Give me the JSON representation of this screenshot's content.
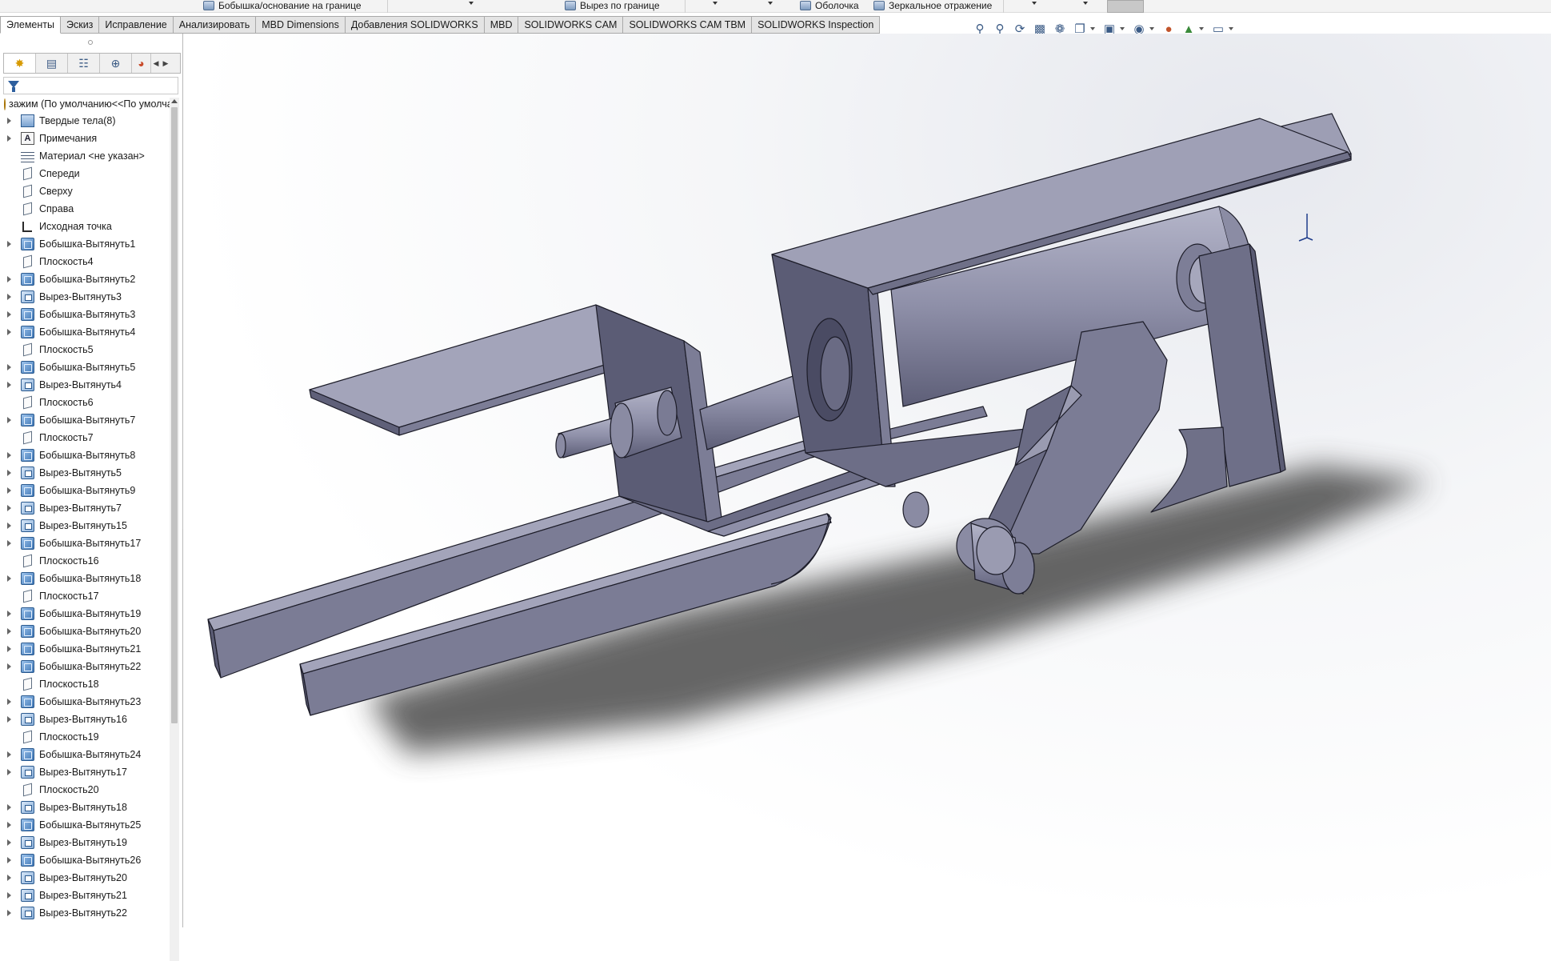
{
  "ribbon": {
    "boss_boundary": "Бобышка/основание на границе",
    "cut_boundary": "Вырез по границе",
    "shell": "Оболочка",
    "mirror": "Зеркальное отражение"
  },
  "tabs": [
    {
      "label": "Элементы",
      "active": true
    },
    {
      "label": "Эскиз",
      "active": false
    },
    {
      "label": "Исправление",
      "active": false
    },
    {
      "label": "Анализировать",
      "active": false
    },
    {
      "label": "MBD Dimensions",
      "active": false
    },
    {
      "label": "Добавления SOLIDWORKS",
      "active": false
    },
    {
      "label": "MBD",
      "active": false
    },
    {
      "label": "SOLIDWORKS CAM",
      "active": false
    },
    {
      "label": "SOLIDWORKS CAM TBM",
      "active": false
    },
    {
      "label": "SOLIDWORKS Inspection",
      "active": false
    }
  ],
  "hud_icons": [
    "zoom-to-fit-icon",
    "zoom-to-area-icon",
    "previous-view-icon",
    "section-view-icon",
    "dynamic-annotation-icon",
    "view-orientation-icon",
    "display-style-icon",
    "hide-show-icon",
    "edit-appearance-icon",
    "apply-scene-icon",
    "view-settings-icon"
  ],
  "panel_tabs": [
    "feature-manager-icon",
    "property-manager-icon",
    "configuration-manager-icon",
    "dimxpert-manager-icon",
    "display-manager-icon"
  ],
  "tree": {
    "root": "зажим  (По умолчанию<<По умолчанию>>",
    "items": [
      {
        "label": "Твердые тела(8)",
        "icon": "solid-bodies-icon",
        "expandable": true
      },
      {
        "label": "Примечания",
        "icon": "annotations-icon",
        "expandable": true
      },
      {
        "label": "Материал <не указан>",
        "icon": "material-icon",
        "expandable": false
      },
      {
        "label": "Спереди",
        "icon": "plane-icon",
        "expandable": false
      },
      {
        "label": "Сверху",
        "icon": "plane-icon",
        "expandable": false
      },
      {
        "label": "Справа",
        "icon": "plane-icon",
        "expandable": false
      },
      {
        "label": "Исходная точка",
        "icon": "origin-icon",
        "expandable": false
      },
      {
        "label": "Бобышка-Вытянуть1",
        "icon": "extrude-boss-icon",
        "expandable": true
      },
      {
        "label": "Плоскость4",
        "icon": "plane-icon",
        "expandable": false
      },
      {
        "label": "Бобышка-Вытянуть2",
        "icon": "extrude-boss-icon",
        "expandable": true
      },
      {
        "label": "Вырез-Вытянуть3",
        "icon": "extrude-cut-icon",
        "expandable": true
      },
      {
        "label": "Бобышка-Вытянуть3",
        "icon": "extrude-boss-icon",
        "expandable": true
      },
      {
        "label": "Бобышка-Вытянуть4",
        "icon": "extrude-boss-icon",
        "expandable": true
      },
      {
        "label": "Плоскость5",
        "icon": "plane-icon",
        "expandable": false
      },
      {
        "label": "Бобышка-Вытянуть5",
        "icon": "extrude-boss-icon",
        "expandable": true
      },
      {
        "label": "Вырез-Вытянуть4",
        "icon": "extrude-cut-icon",
        "expandable": true
      },
      {
        "label": "Плоскость6",
        "icon": "plane-icon",
        "expandable": false
      },
      {
        "label": "Бобышка-Вытянуть7",
        "icon": "extrude-boss-icon",
        "expandable": true
      },
      {
        "label": "Плоскость7",
        "icon": "plane-icon",
        "expandable": false
      },
      {
        "label": "Бобышка-Вытянуть8",
        "icon": "extrude-boss-icon",
        "expandable": true
      },
      {
        "label": "Вырез-Вытянуть5",
        "icon": "extrude-cut-icon",
        "expandable": true
      },
      {
        "label": "Бобышка-Вытянуть9",
        "icon": "extrude-boss-icon",
        "expandable": true
      },
      {
        "label": "Вырез-Вытянуть7",
        "icon": "extrude-cut-icon",
        "expandable": true
      },
      {
        "label": "Вырез-Вытянуть15",
        "icon": "extrude-cut-icon",
        "expandable": true
      },
      {
        "label": "Бобышка-Вытянуть17",
        "icon": "extrude-boss-icon",
        "expandable": true
      },
      {
        "label": "Плоскость16",
        "icon": "plane-icon",
        "expandable": false
      },
      {
        "label": "Бобышка-Вытянуть18",
        "icon": "extrude-boss-icon",
        "expandable": true
      },
      {
        "label": "Плоскость17",
        "icon": "plane-icon",
        "expandable": false
      },
      {
        "label": "Бобышка-Вытянуть19",
        "icon": "extrude-boss-icon",
        "expandable": true
      },
      {
        "label": "Бобышка-Вытянуть20",
        "icon": "extrude-boss-icon",
        "expandable": true
      },
      {
        "label": "Бобышка-Вытянуть21",
        "icon": "extrude-boss-icon",
        "expandable": true
      },
      {
        "label": "Бобышка-Вытянуть22",
        "icon": "extrude-boss-icon",
        "expandable": true
      },
      {
        "label": "Плоскость18",
        "icon": "plane-icon",
        "expandable": false
      },
      {
        "label": "Бобышка-Вытянуть23",
        "icon": "extrude-boss-icon",
        "expandable": true
      },
      {
        "label": "Вырез-Вытянуть16",
        "icon": "extrude-cut-icon",
        "expandable": true
      },
      {
        "label": "Плоскость19",
        "icon": "plane-icon",
        "expandable": false
      },
      {
        "label": "Бобышка-Вытянуть24",
        "icon": "extrude-boss-icon",
        "expandable": true
      },
      {
        "label": "Вырез-Вытянуть17",
        "icon": "extrude-cut-icon",
        "expandable": true
      },
      {
        "label": "Плоскость20",
        "icon": "plane-icon",
        "expandable": false
      },
      {
        "label": "Вырез-Вытянуть18",
        "icon": "extrude-cut-icon",
        "expandable": true
      },
      {
        "label": "Бобышка-Вытянуть25",
        "icon": "extrude-boss-icon",
        "expandable": true
      },
      {
        "label": "Вырез-Вытянуть19",
        "icon": "extrude-cut-icon",
        "expandable": true
      },
      {
        "label": "Бобышка-Вытянуть26",
        "icon": "extrude-boss-icon",
        "expandable": true
      },
      {
        "label": "Вырез-Вытянуть20",
        "icon": "extrude-cut-icon",
        "expandable": true
      },
      {
        "label": "Вырез-Вытянуть21",
        "icon": "extrude-cut-icon",
        "expandable": true
      },
      {
        "label": "Вырез-Вытянуть22",
        "icon": "extrude-cut-icon",
        "expandable": true
      }
    ]
  },
  "colors": {
    "model_top": "#9fa0b6",
    "model_side": "#6f7088",
    "model_dark": "#50516a",
    "model_edge": "#1c1c28",
    "shadow": "#4a4a4a",
    "accent": "#2e5f9e"
  }
}
